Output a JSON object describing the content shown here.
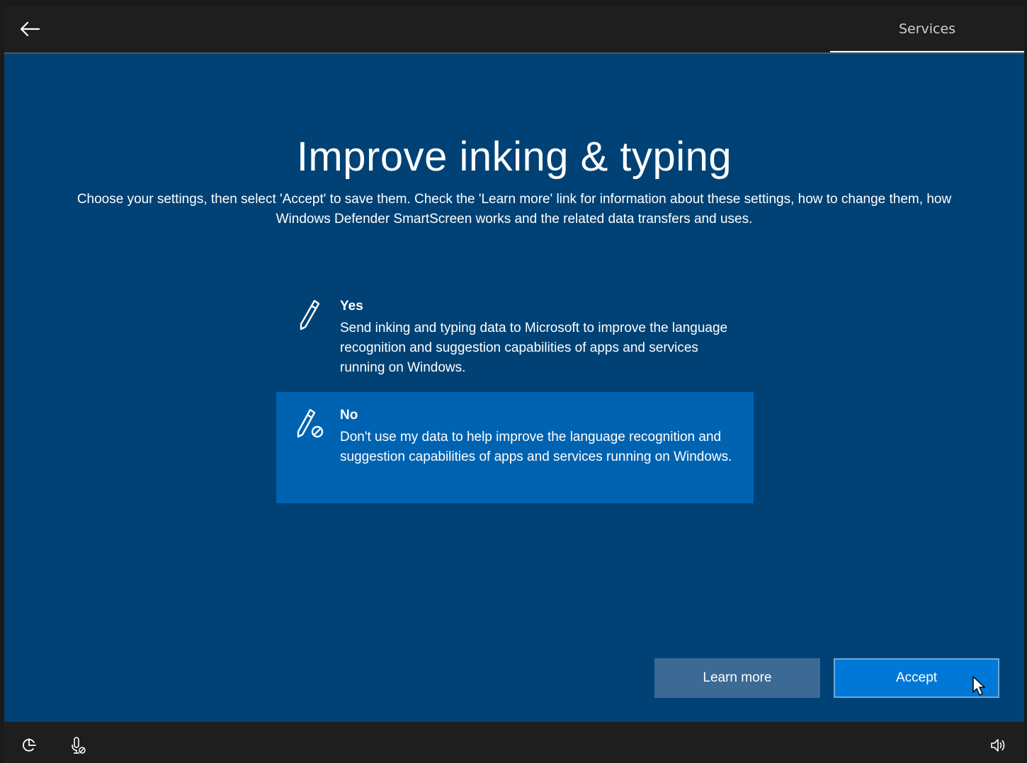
{
  "topbar": {
    "tab_label": "Services"
  },
  "main": {
    "title": "Improve inking & typing",
    "subtitle": "Choose your settings, then select 'Accept' to save them. Check the 'Learn more' link for information about these settings, how to change them, how Windows Defender SmartScreen works and the related data transfers and uses."
  },
  "options": [
    {
      "title": "Yes",
      "description": "Send inking and typing data to Microsoft to improve the language recognition and suggestion capabilities of apps and services running on Windows.",
      "icon": "pen-icon",
      "selected": false
    },
    {
      "title": "No",
      "description": "Don't use my data to help improve the language recognition and suggestion capabilities of apps and services running on Windows.",
      "icon": "pen-blocked-icon",
      "selected": true
    }
  ],
  "buttons": {
    "learn_more": "Learn more",
    "accept": "Accept"
  },
  "icons": {
    "back": "back-arrow-icon",
    "accessibility": "ease-of-access-icon",
    "microphone": "microphone-icon",
    "volume": "volume-icon"
  },
  "colors": {
    "background": "#004275",
    "selected_option": "#0063b1",
    "accept_button": "#0078d7",
    "learn_more_button": "#3c6a94",
    "bar": "#1e1e1e"
  }
}
